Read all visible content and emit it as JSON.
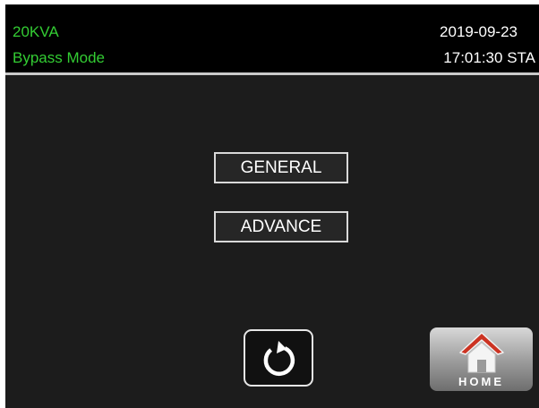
{
  "header": {
    "model": "20KVA",
    "mode": "Bypass Mode",
    "date": "2019-09-23",
    "time": "17:01:30 STA"
  },
  "menu": {
    "general_label": "GENERAL",
    "advance_label": "ADVANCE"
  },
  "footer": {
    "back_icon": "refresh-back-icon",
    "home_icon": "house-icon",
    "home_label": "HOME"
  },
  "colors": {
    "status_green": "#33cc33",
    "background": "#1c1c1c",
    "topbar": "#000000",
    "home_roof": "#cc3322"
  }
}
